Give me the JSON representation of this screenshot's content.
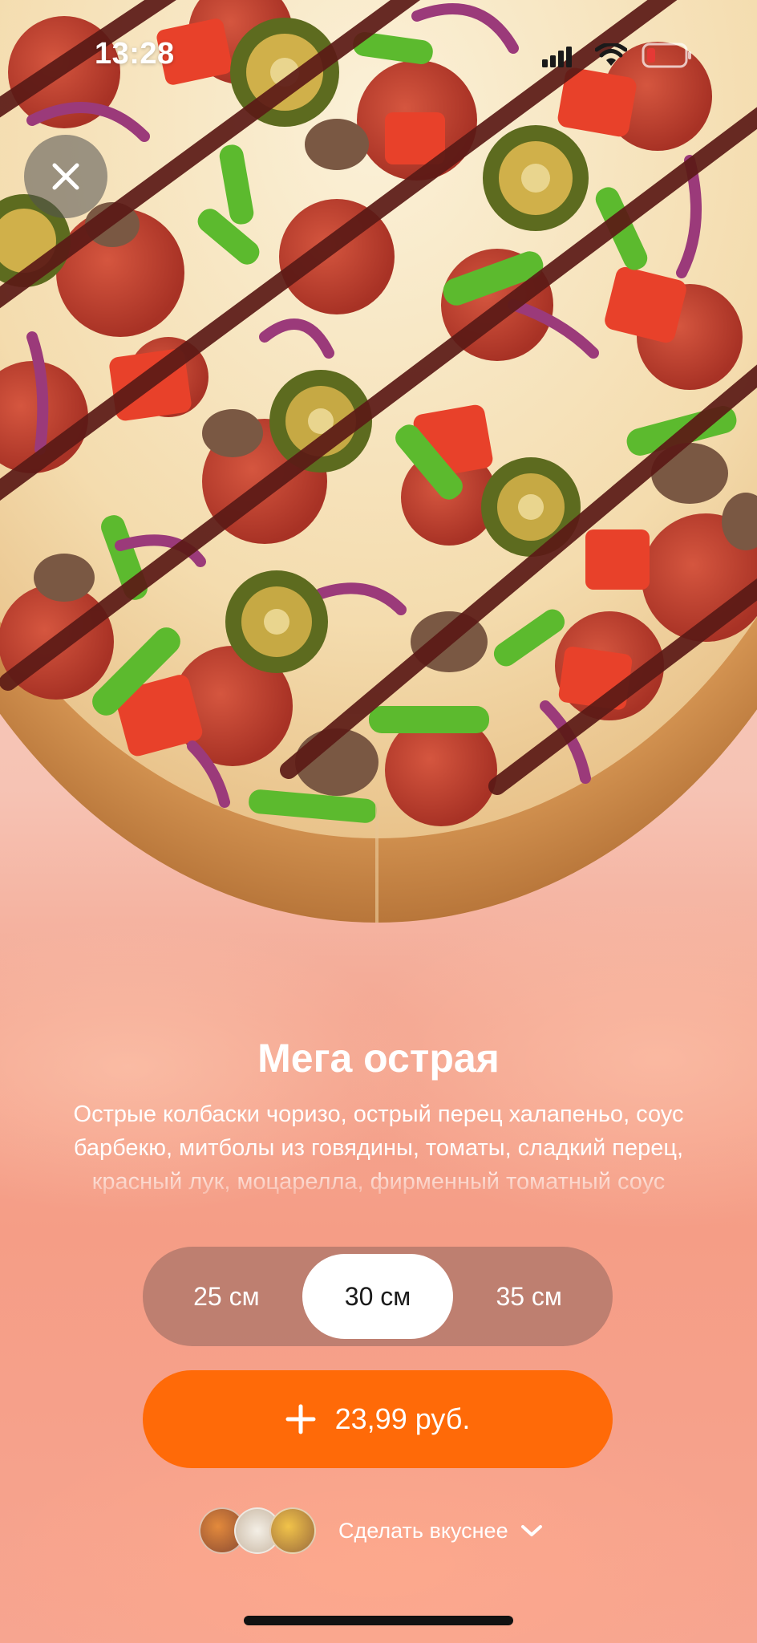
{
  "status_bar": {
    "time": "13:28"
  },
  "product": {
    "title": "Мега острая",
    "description": "Острые колбаски чоризо, острый перец халапеньо, соус барбекю, митболы из говядины, томаты, сладкий перец, красный лук, моцарелла, фирменный томатный соус"
  },
  "size_selector": {
    "options": [
      {
        "label": "25 см",
        "selected": false
      },
      {
        "label": "30 см",
        "selected": true
      },
      {
        "label": "35 см",
        "selected": false
      }
    ]
  },
  "add_to_cart": {
    "price_label": "23,99 руб."
  },
  "upsell": {
    "label": "Сделать вкуснее"
  },
  "colors": {
    "accent": "#ff6a08",
    "background_peach": "#f6c3b4",
    "selector_track": "#a06e64"
  },
  "icons": [
    "close-icon",
    "signal-icon",
    "wifi-icon",
    "battery-icon",
    "plus-icon",
    "chevron-down-icon"
  ]
}
